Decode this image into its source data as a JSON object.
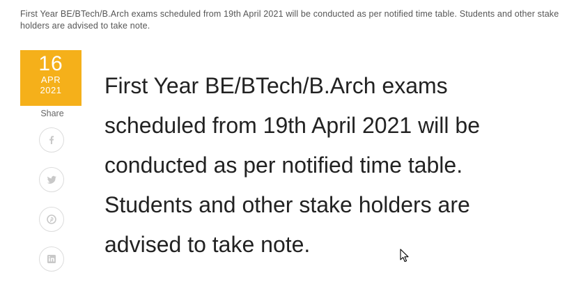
{
  "notice": {
    "text": "First Year BE/BTech/B.Arch exams scheduled from 19th April 2021 will be conducted as per notified time table. Students and other stake holders are advised to take note."
  },
  "post_date": {
    "day": "16",
    "month": "APR",
    "year": "2021"
  },
  "share": {
    "label": "Share",
    "buttons": [
      {
        "icon": "facebook-icon"
      },
      {
        "icon": "twitter-icon"
      },
      {
        "icon": "pinterest-icon"
      },
      {
        "icon": "linkedin-icon"
      }
    ]
  },
  "article": {
    "title": "First Year BE/BTech/B.Arch exams scheduled from 19th April 2021 will be conducted as per notified time table. Students and other stake holders are advised to take note."
  },
  "colors": {
    "date_badge": "#f5b01a",
    "share_icon": "#c8c8c8"
  }
}
